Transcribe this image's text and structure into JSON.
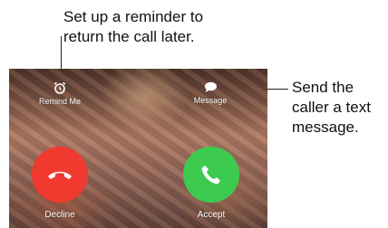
{
  "callouts": {
    "reminder": {
      "line1": "Set up a reminder to",
      "line2": "return the call later."
    },
    "message": {
      "line1": "Send the",
      "line2": "caller a text",
      "line3": "message."
    }
  },
  "call_screen": {
    "options": [
      {
        "label": "Remind Me",
        "icon": "alarm-clock-icon"
      },
      {
        "label": "Message",
        "icon": "speech-bubble-icon"
      }
    ],
    "actions": [
      {
        "label": "Decline",
        "icon": "phone-hangup-icon",
        "color": "#f03a30"
      },
      {
        "label": "Accept",
        "icon": "phone-icon",
        "color": "#3ccb4f"
      }
    ]
  }
}
